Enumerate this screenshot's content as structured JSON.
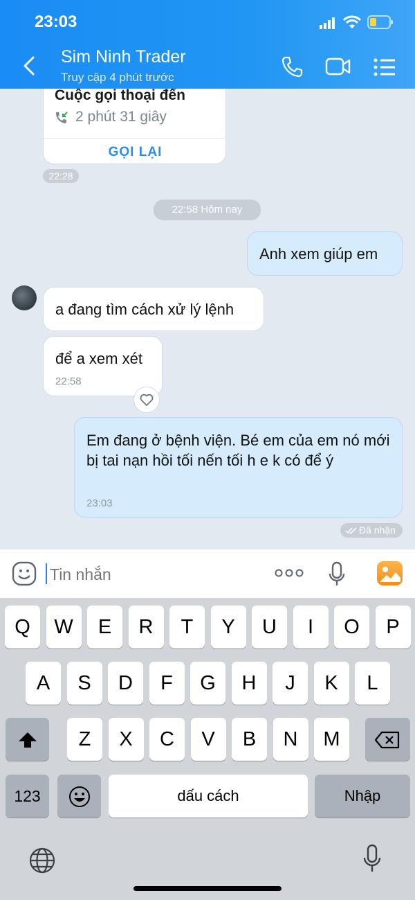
{
  "status_bar": {
    "time": "23:03"
  },
  "header": {
    "title": "Sim Ninh Trader",
    "subtitle": "Truy cập 4 phút trước"
  },
  "call_card": {
    "title": "Cuộc gọi thoại đến",
    "duration": "2 phút 31 giây",
    "action": "GỌI LẠI",
    "time": "22:28"
  },
  "date_separator": "22:58 Hôm nay",
  "messages": [
    {
      "from": "me",
      "text": "Anh xem giúp em"
    },
    {
      "from": "them",
      "text": "a đang tìm cách xử lý lệnh"
    },
    {
      "from": "them",
      "text": "để a xem xét",
      "time": "22:58"
    },
    {
      "from": "me",
      "text": "Em đang ở bệnh viện. Bé em của em nó mới bị tai nạn hồi tối nến tối h e k có để ý",
      "time": "23:03"
    }
  ],
  "delivery_status": "Đã nhận",
  "input": {
    "placeholder": "Tin nhắn"
  },
  "keyboard": {
    "row1": [
      "Q",
      "W",
      "E",
      "R",
      "T",
      "Y",
      "U",
      "I",
      "O",
      "P"
    ],
    "row2": [
      "A",
      "S",
      "D",
      "F",
      "G",
      "H",
      "J",
      "K",
      "L"
    ],
    "row3": [
      "Z",
      "X",
      "C",
      "V",
      "B",
      "N",
      "M"
    ],
    "numbers_key": "123",
    "space_key": "dấu cách",
    "return_key": "Nhập"
  },
  "colors": {
    "header": "#2196f3",
    "my_bubble": "#d6ecfd",
    "chat_bg": "#e2e9f1",
    "accent_link": "#2b8cf0"
  },
  "icons": [
    "back-icon",
    "phone-icon",
    "video-icon",
    "menu-icon",
    "sticker-icon",
    "more-icon",
    "mic-icon",
    "gallery-icon",
    "shift-icon",
    "backspace-icon",
    "emoji-icon",
    "globe-icon",
    "dictation-icon",
    "avatar"
  ]
}
